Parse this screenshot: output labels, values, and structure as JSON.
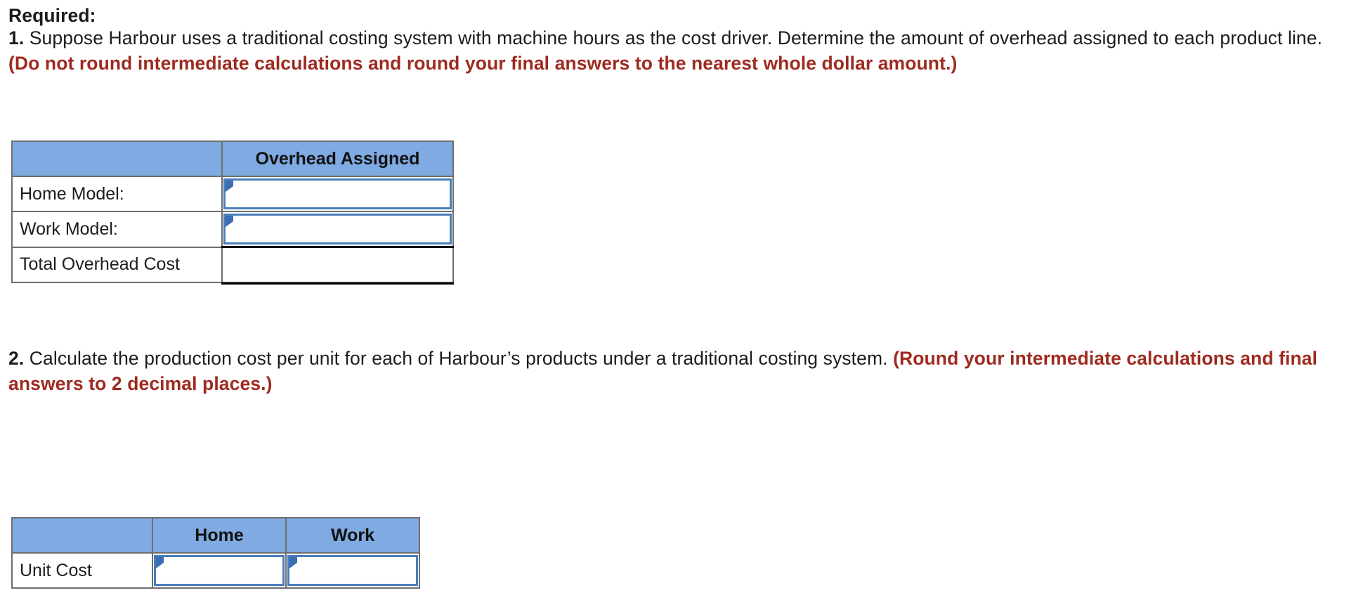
{
  "required_heading": "Required:",
  "question1": {
    "number": "1.",
    "text_before_hint": " Suppose Harbour uses a traditional costing system with machine hours as the cost driver. Determine the amount of overhead assigned to each product line. ",
    "hint": "(Do not round intermediate calculations and round your final answers to the nearest whole dollar amount.)"
  },
  "question2": {
    "number": "2.",
    "text_before_hint": " Calculate the production cost per unit for each of Harbour’s products under a traditional costing system. ",
    "hint": "(Round your intermediate calculations and final answers to 2 decimal places.)"
  },
  "table_overhead": {
    "headers": [
      "",
      "Overhead Assigned"
    ],
    "rows": [
      {
        "label": "Home Model:",
        "value": "",
        "type": "input"
      },
      {
        "label": "Work Model:",
        "value": "",
        "type": "input"
      },
      {
        "label": "Total Overhead Cost",
        "value": "",
        "type": "total"
      }
    ]
  },
  "table_unitcost": {
    "headers": [
      "",
      "Home",
      "Work"
    ],
    "rows": [
      {
        "label": "Unit Cost",
        "home": "",
        "work": ""
      }
    ]
  },
  "colors": {
    "header_blue": "#7faae2",
    "input_border_blue": "#4a7ebb",
    "flag_blue": "#3a6db3",
    "hint_red": "#9e2a20",
    "grid_gray": "#6e6e6e",
    "text": "#1c1c1c"
  }
}
